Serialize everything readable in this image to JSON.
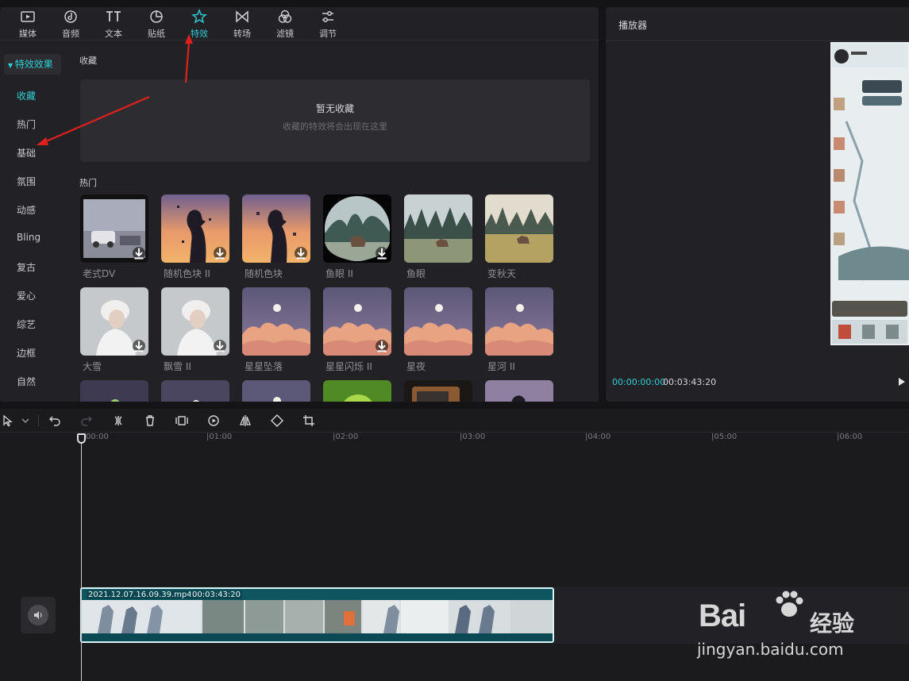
{
  "toolbar": {
    "tabs": [
      {
        "label": "媒体",
        "icon": "media-icon"
      },
      {
        "label": "音频",
        "icon": "audio-icon"
      },
      {
        "label": "文本",
        "icon": "text-icon"
      },
      {
        "label": "贴纸",
        "icon": "sticker-icon"
      },
      {
        "label": "特效",
        "icon": "effects-star-icon",
        "active": true
      },
      {
        "label": "转场",
        "icon": "transition-icon"
      },
      {
        "label": "滤镜",
        "icon": "filter-icon"
      },
      {
        "label": "调节",
        "icon": "adjust-icon"
      }
    ]
  },
  "sidebar": {
    "header": "特效效果",
    "items": [
      "收藏",
      "热门",
      "基础",
      "氛围",
      "动感",
      "Bling",
      "复古",
      "爱心",
      "综艺",
      "边框",
      "自然"
    ],
    "active_index": 0
  },
  "favorites": {
    "title": "收藏",
    "empty_title": "暂无收藏",
    "empty_subtitle": "收藏的特效将会出现在这里"
  },
  "hot": {
    "title": "热门",
    "items": [
      "老式DV",
      "随机色块 II",
      "随机色块",
      "鱼眼 II",
      "鱼眼",
      "变秋天",
      "大雪",
      "飘雪 II",
      "星星坠落",
      "星星闪烁 II",
      "星夜",
      "星河 II"
    ]
  },
  "player": {
    "title": "播放器",
    "current_time": "00:00:00:00",
    "total_time": "00:03:43:20"
  },
  "timeline": {
    "ruler_labels": [
      "00:00",
      "|01:00",
      "|02:00",
      "|03:00",
      "|04:00",
      "|05:00",
      "|06:00"
    ],
    "clip_name": "2021.12.07.16.09.39.mp4",
    "clip_duration": "00:03:43:20"
  },
  "watermark": {
    "brand": "Bai",
    "brand_suffix": "经验",
    "url": "jingyan.baidu.com"
  },
  "colors": {
    "accent": "#2fd1d7",
    "panel": "#222226",
    "background": "#141416",
    "clip": "#0e5560"
  }
}
